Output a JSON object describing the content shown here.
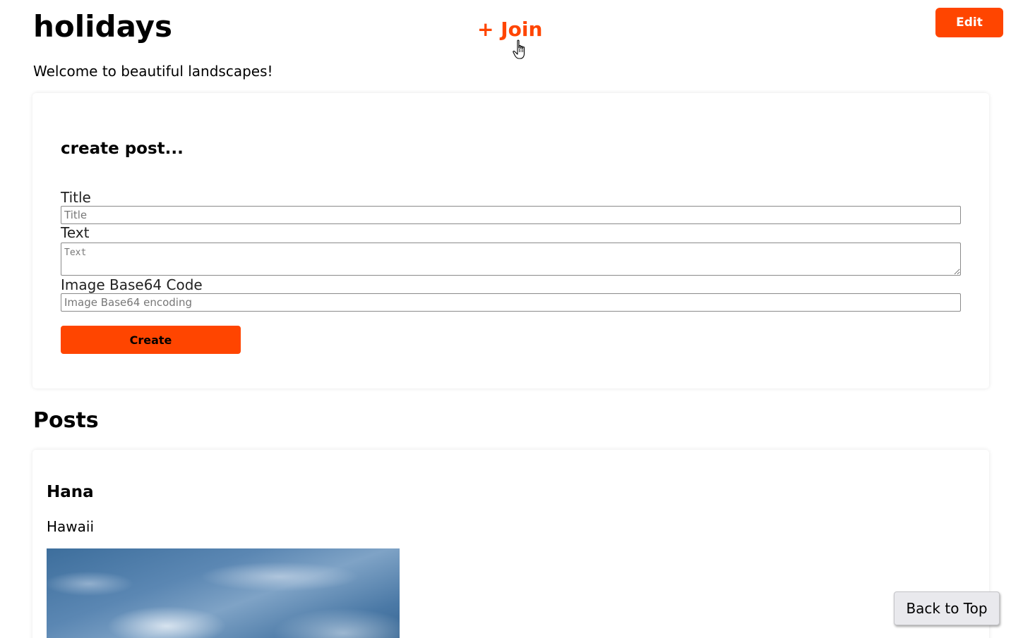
{
  "header": {
    "title": "holidays",
    "join_label": "+ Join",
    "edit_label": "Edit",
    "description": "Welcome to beautiful landscapes!"
  },
  "create_post": {
    "heading": "create post...",
    "title_label": "Title",
    "title_placeholder": "Title",
    "text_label": "Text",
    "text_placeholder": "Text",
    "image_label": "Image Base64 Code",
    "image_placeholder": "Image Base64 encoding",
    "create_label": "Create"
  },
  "posts": {
    "heading": "Posts",
    "items": [
      {
        "title": "Hana",
        "text": "Hawaii",
        "image_description": "sky-with-clouds"
      }
    ]
  },
  "back_to_top_label": "Back to Top",
  "colors": {
    "accent": "#ff4500",
    "background": "#ffffff",
    "button_gray": "#e9e9ed"
  },
  "icons": {
    "cursor": "hand-pointer-icon"
  }
}
